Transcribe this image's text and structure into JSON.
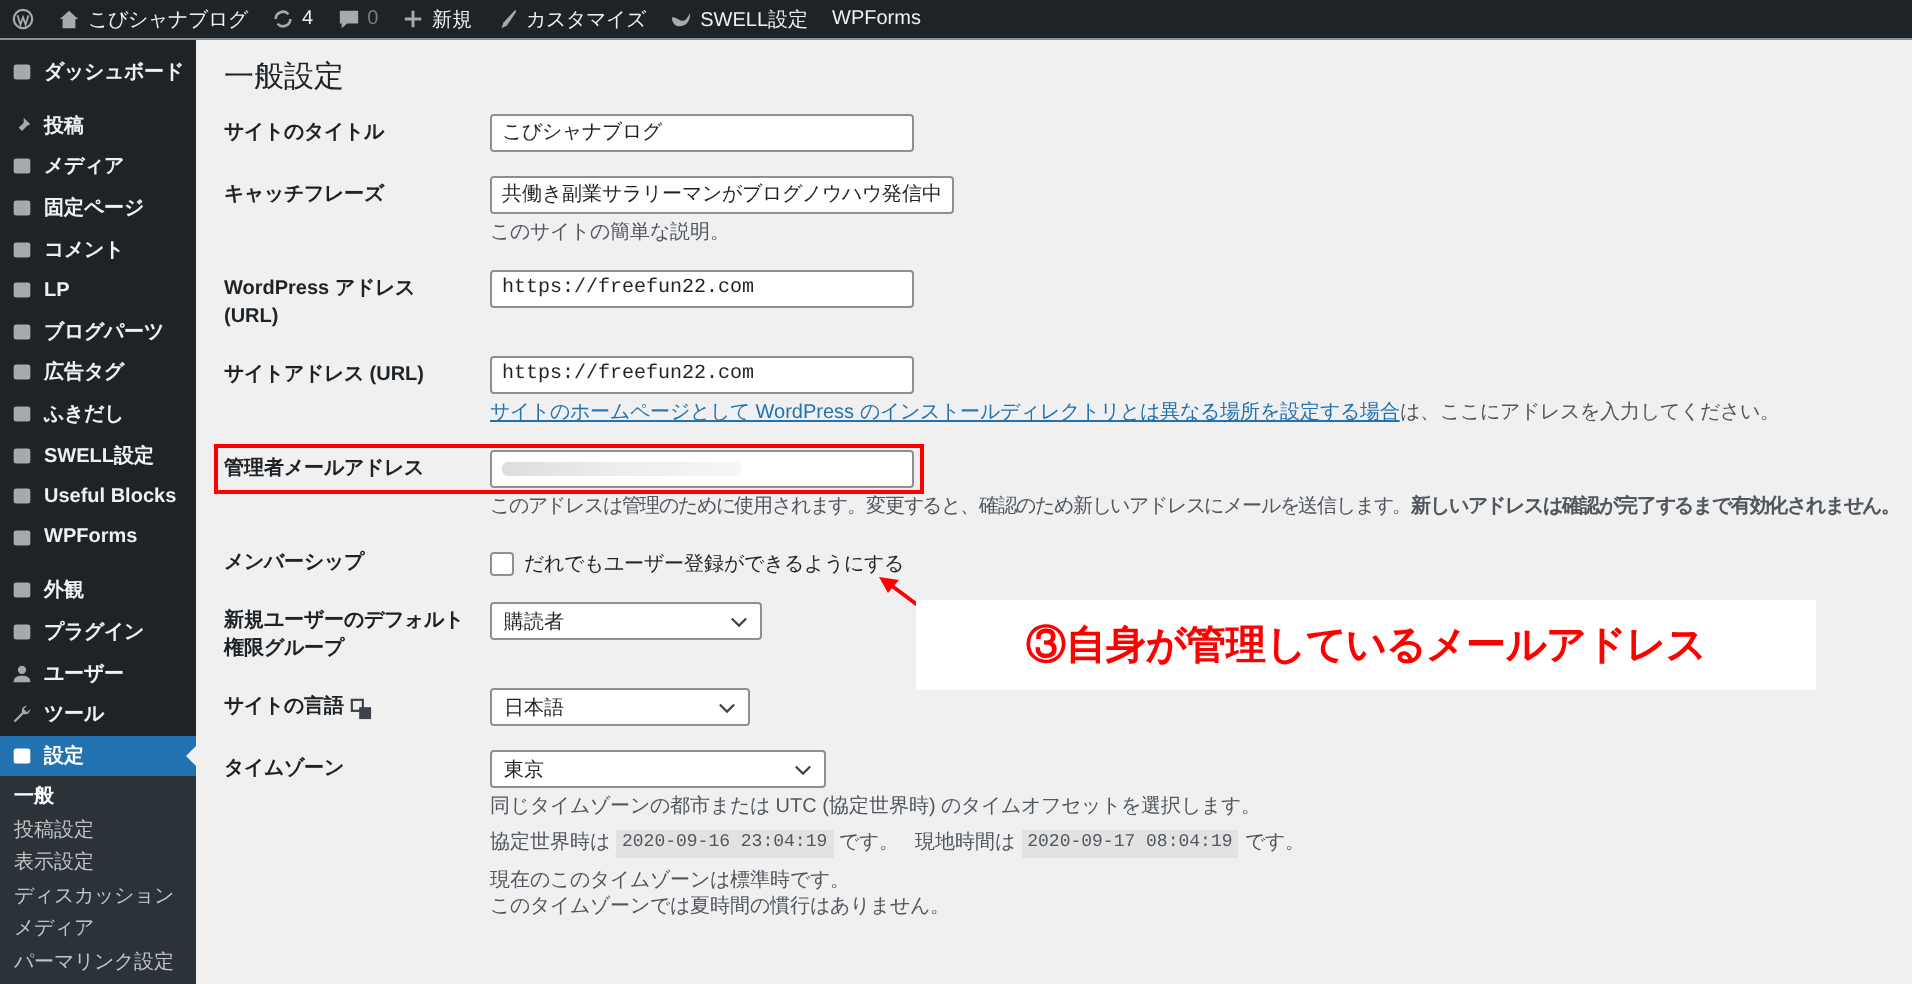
{
  "admin_bar": {
    "items": [
      {
        "kind": "logo"
      },
      {
        "kind": "home",
        "label": "こびシャナブログ"
      },
      {
        "kind": "updates",
        "label": "4"
      },
      {
        "kind": "comments",
        "label": "0"
      },
      {
        "kind": "new",
        "label": "新規"
      },
      {
        "kind": "customize",
        "label": "カスタマイズ"
      },
      {
        "kind": "swell",
        "label": "SWELL設定"
      },
      {
        "kind": "text",
        "label": "WPForms"
      }
    ]
  },
  "sidebar": {
    "items": [
      {
        "label": "ダッシュボード",
        "selected": false
      },
      {
        "label": "投稿",
        "selected": false
      },
      {
        "label": "メディア",
        "selected": false
      },
      {
        "label": "固定ページ",
        "selected": false
      },
      {
        "label": "コメント",
        "selected": false
      },
      {
        "label": "LP",
        "selected": false
      },
      {
        "label": "ブログパーツ",
        "selected": false
      },
      {
        "label": "広告タグ",
        "selected": false
      },
      {
        "label": "ふきだし",
        "selected": false
      },
      {
        "label": "SWELL設定",
        "selected": false
      },
      {
        "label": "Useful Blocks",
        "selected": false
      },
      {
        "label": "WPForms",
        "selected": false
      },
      {
        "label": "外観",
        "selected": false
      },
      {
        "label": "プラグイン",
        "selected": false
      },
      {
        "label": "ユーザー",
        "selected": false
      },
      {
        "label": "ツール",
        "selected": false
      },
      {
        "label": "設定",
        "selected": true
      }
    ],
    "submenu": [
      {
        "label": "一般",
        "selected": true
      },
      {
        "label": "投稿設定",
        "selected": false
      },
      {
        "label": "表示設定",
        "selected": false
      },
      {
        "label": "ディスカッション",
        "selected": false
      },
      {
        "label": "メディア",
        "selected": false
      },
      {
        "label": "パーマリンク設定",
        "selected": false
      }
    ]
  },
  "page_title": "一般設定",
  "fields": [
    {
      "kind": "text",
      "label": "サイトのタイトル",
      "value": "こびシャナブログ"
    },
    {
      "kind": "text",
      "label": "キャッチフレーズ",
      "value": "共働き副業サラリーマンがブログノウハウ発信中",
      "description": "このサイトの簡単な説明。"
    },
    {
      "kind": "url",
      "label": "WordPress アドレス (URL)",
      "value": "https://freefun22.com"
    },
    {
      "kind": "url",
      "label": "サイトアドレス (URL)",
      "value": "https://freefun22.com",
      "link": "サイトのホームページとして WordPress のインストールディレクトリとは異なる場所を設定する場合",
      "link_suffix": "は、ここにアドレスを入力してください。"
    },
    {
      "kind": "email",
      "label": "管理者メールアドレス",
      "description": "このアドレスは管理のために使用されます。変更すると、確認のため新しいアドレスにメールを送信します。**新しいアドレスは確認が完了するまで有効化されません。**"
    },
    {
      "kind": "checkbox",
      "label": "メンバーシップ",
      "option": "だれでもユーザー登録ができるようにする",
      "checked": false
    },
    {
      "kind": "role",
      "label": "新規ユーザーのデフォルト権限グループ",
      "value": "購読者"
    },
    {
      "kind": "language",
      "label": "サイトの言語",
      "value": "日本語"
    },
    {
      "kind": "timezone",
      "label": "タイムゾーン",
      "value": "東京",
      "description": "同じタイムゾーンの都市または UTC (協定世界時) のタイムオフセットを選択します。",
      "utc_label": "協定世界時は",
      "utc_time": "2020-09-16 23:04:19",
      "utc_suffix": "です。",
      "local_label": "現地時間は",
      "local_time": "2020-09-17 08:04:19",
      "local_suffix": "です。",
      "notes": [
        "現在のこのタイムゾーンは標準時です。",
        "このタイムゾーンでは夏時間の慣行はありません。"
      ]
    }
  ],
  "callout": {
    "text": "③自身が管理しているメールアドレス"
  }
}
